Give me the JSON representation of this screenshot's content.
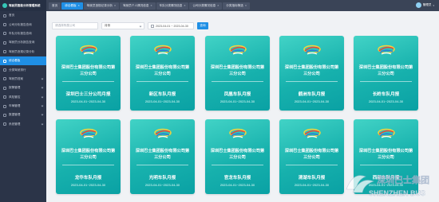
{
  "app": {
    "title": "驾驶员智能分析管理系统"
  },
  "sidebar": {
    "items": [
      {
        "label": "首页",
        "active": false,
        "has_children": false
      },
      {
        "label": "公司分析报告查询",
        "active": false,
        "has_children": false
      },
      {
        "label": "车队分析报告查询",
        "active": false,
        "has_children": false
      },
      {
        "label": "驾驶员分析报告查询",
        "active": false,
        "has_children": false
      },
      {
        "label": "驾驶员违规记录分析",
        "active": false,
        "has_children": false
      },
      {
        "label": "综合看板",
        "active": true,
        "has_children": false
      },
      {
        "label": "分类驾驶排行",
        "active": false,
        "has_children": false
      },
      {
        "label": "驾驶员档案",
        "active": false,
        "has_children": true
      },
      {
        "label": "报警管理",
        "active": false,
        "has_children": true
      },
      {
        "label": "风险管控",
        "active": false,
        "has_children": true
      },
      {
        "label": "车辆管理",
        "active": false,
        "has_children": true
      },
      {
        "label": "数据管理",
        "active": false,
        "has_children": true
      },
      {
        "label": "系统管理",
        "active": false,
        "has_children": true
      }
    ]
  },
  "topbar": {
    "tabs": [
      {
        "label": "首页",
        "closable": false,
        "active": false
      },
      {
        "label": "综合看板",
        "closable": true,
        "active": true
      },
      {
        "label": "驾驶员违规记录分析",
        "closable": true,
        "active": false
      },
      {
        "label": "驾驶员个人情况信息",
        "closable": true,
        "active": false
      },
      {
        "label": "车队分类情况信息",
        "closable": true,
        "active": false
      },
      {
        "label": "公司分类情况信息",
        "closable": true,
        "active": false
      },
      {
        "label": "分类指标筛选",
        "closable": true,
        "active": false
      }
    ],
    "user": {
      "name": "管理员",
      "caret": "▾"
    }
  },
  "filters": {
    "company_placeholder": "请选择所属公司",
    "period_value": "月份",
    "date_range": "2023-04-01 ~ 2023-04-30",
    "search_label": "查询"
  },
  "cards": [
    {
      "company": "深圳巴士集团股份有限公司第三分公司",
      "title": "深圳巴士三分公司月报",
      "dates": "2023-04-01~2023-04-30"
    },
    {
      "company": "深圳巴士集团股份有限公司第三分公司",
      "title": "新区车队月报",
      "dates": "2023-04-01~2023-04-30"
    },
    {
      "company": "深圳巴士集团股份有限公司第三分公司",
      "title": "凤凰车队月报",
      "dates": "2023-04-01~2023-04-30"
    },
    {
      "company": "深圳巴士集团股份有限公司第三分公司",
      "title": "鹤洲车队月报",
      "dates": "2023-04-01~2023-04-30"
    },
    {
      "company": "深圳巴士集团股份有限公司第三分公司",
      "title": "长岭车队月报",
      "dates": "2023-04-01~2023-04-30"
    },
    {
      "company": "深圳巴士集团股份有限公司第三分公司",
      "title": "龙华车队月报",
      "dates": "2023-04-01~2023-04-30"
    },
    {
      "company": "深圳巴士集团股份有限公司第三分公司",
      "title": "光明车队月报",
      "dates": "2023-04-01~2023-04-30"
    },
    {
      "company": "深圳巴士集团股份有限公司第三分公司",
      "title": "官龙车队月报",
      "dates": "2023-04-01~2023-04-30"
    },
    {
      "company": "深圳巴士集团股份有限公司第三分公司",
      "title": "清湖车队月报",
      "dates": "2023-04-01~2023-04-30"
    },
    {
      "company": "深圳巴士集团股份有限公司第三分公司",
      "title": "西部车队月报",
      "dates": "2023-04-01~2023-04-30"
    }
  ],
  "watermark": {
    "text_cn": "深圳巴士集团",
    "text_en": "SHENZHEN BUS"
  },
  "colors": {
    "accent": "#1f8fe5",
    "sidebar": "#2b3448",
    "card_top": "#42d3c6",
    "card_bottom": "#0aa1a4"
  }
}
